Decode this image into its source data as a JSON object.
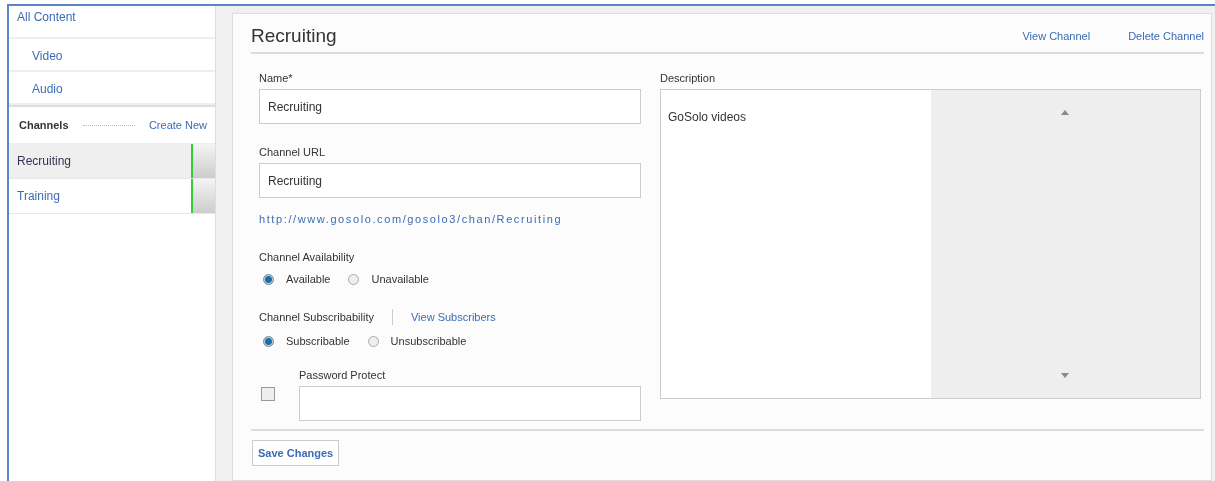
{
  "sidebar": {
    "items": [
      {
        "label": "All Content",
        "kind": "top"
      },
      {
        "label": "Video",
        "kind": "sub"
      },
      {
        "label": "Audio",
        "kind": "sub"
      }
    ],
    "channels_header": {
      "label": "Channels",
      "action": "Create New"
    },
    "channels": [
      {
        "label": "Recruiting",
        "selected": true
      },
      {
        "label": "Training",
        "selected": false
      }
    ]
  },
  "header": {
    "title": "Recruiting",
    "links": [
      "View Channel",
      "Delete Channel"
    ]
  },
  "form": {
    "name": {
      "label": "Name*",
      "value": "Recruiting"
    },
    "url": {
      "label": "Channel URL",
      "value": "Recruiting",
      "link": "http://www.gosolo.com/gosolo3/chan/Recruiting"
    },
    "availability": {
      "label": "Channel Availability",
      "options": [
        {
          "label": "Available",
          "selected": true
        },
        {
          "label": "Unavailable",
          "selected": false
        }
      ]
    },
    "subscribability": {
      "label": "Channel Subscribability",
      "link": "View Subscribers",
      "options": [
        {
          "label": "Subscribable",
          "selected": true
        },
        {
          "label": "Unsubscribable",
          "selected": false
        }
      ]
    },
    "password": {
      "label": "Password Protect",
      "checked": false
    },
    "description": {
      "label": "Description",
      "value": "GoSolo videos"
    }
  },
  "buttons": [
    "Save Changes"
  ]
}
